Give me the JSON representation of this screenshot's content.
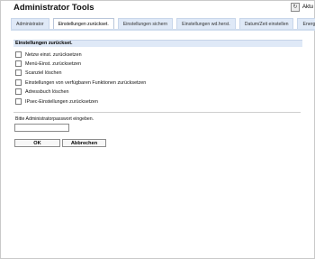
{
  "app": {
    "title": "Administrator Tools",
    "top_right_label": "Aktu"
  },
  "tabs": [
    {
      "label": "Administrator"
    },
    {
      "label": "Einstellungen zurückset."
    },
    {
      "label": "Einstellungen sichern"
    },
    {
      "label": "Einstellungen wd.herst."
    },
    {
      "label": "Datum/Zeit einstellen"
    },
    {
      "label": "Energiespar"
    }
  ],
  "section": {
    "title": "Einstellungen zurückset."
  },
  "options": [
    {
      "label": "Netzw einst. zurücksetzen"
    },
    {
      "label": "Menü-Einst. zurücksetzen"
    },
    {
      "label": "Scanziel löschen"
    },
    {
      "label": "Einstellungen von verfügbaren Funktionen zurücksetzen"
    },
    {
      "label": "Adressbuch löschen"
    },
    {
      "label": "IPsec-Einstellungen zurücksetzen"
    }
  ],
  "password": {
    "label": "Bitte Administratorpasswort eingeben.",
    "value": ""
  },
  "buttons": {
    "ok": "OK",
    "cancel": "Abbrechen"
  }
}
